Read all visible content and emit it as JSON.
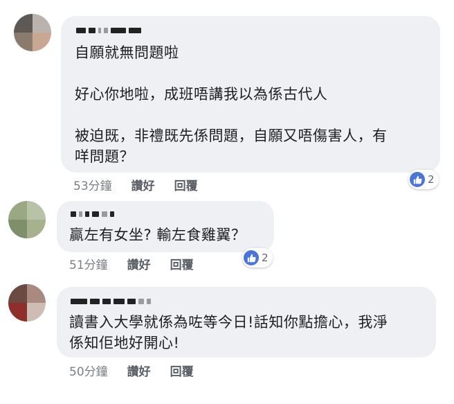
{
  "comments": [
    {
      "text": "自願就無問題啦\n\n好心你地啦，成班唔講我以為係古代人\n\n被迫既，非禮既先係問題，自願又唔傷害人，有\n咩問題？",
      "time": "53分鐘",
      "like_label": "讚好",
      "reply_label": "回覆",
      "reaction_count": "2"
    },
    {
      "text": "贏左有女坐? 輸左食雞翼？",
      "time": "51分鐘",
      "like_label": "讚好",
      "reply_label": "回覆",
      "reaction_count": "2"
    },
    {
      "text": "讀書入大學就係為咗等今日!話知你點擔心，我淨\n係知佢地好開心!",
      "time": "50分鐘",
      "like_label": "讚好",
      "reply_label": "回覆"
    }
  ],
  "colors": {
    "bubble": "#eef0f3",
    "text": "#1c1e21",
    "meta": "#606770",
    "like_blue": "#4a76d8"
  },
  "icons": {
    "reaction": "thumbs-up-icon"
  }
}
